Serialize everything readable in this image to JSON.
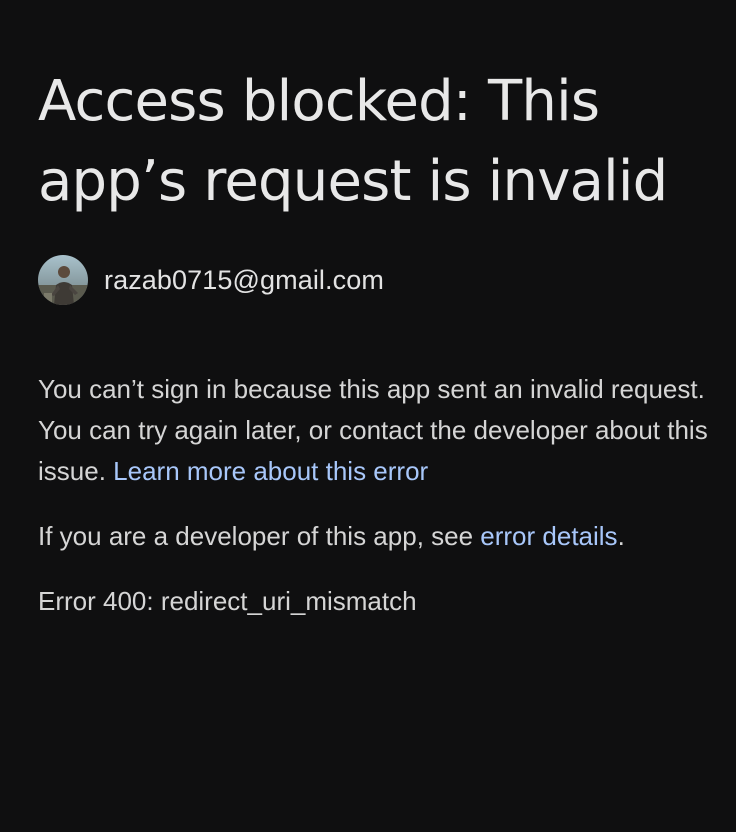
{
  "heading": {
    "line1": "Access blocked: This",
    "line2": "app’s request is invalid"
  },
  "account": {
    "avatar_icon": "user-avatar-photo",
    "email": "razab0715@gmail.com"
  },
  "message": {
    "text": "You can’t sign in because this app sent an invalid request. You can try again later, or contact the developer about this issue. ",
    "learn_more_link": "Learn more about this error"
  },
  "developer_note": {
    "prefix": "If you are a developer of this app, see ",
    "link": "error details",
    "suffix": "."
  },
  "error": {
    "code_text": "Error 400: redirect_uri_mismatch"
  },
  "colors": {
    "background": "#0f0f10",
    "text": "#e3e3e3",
    "link": "#a8c7fa"
  }
}
